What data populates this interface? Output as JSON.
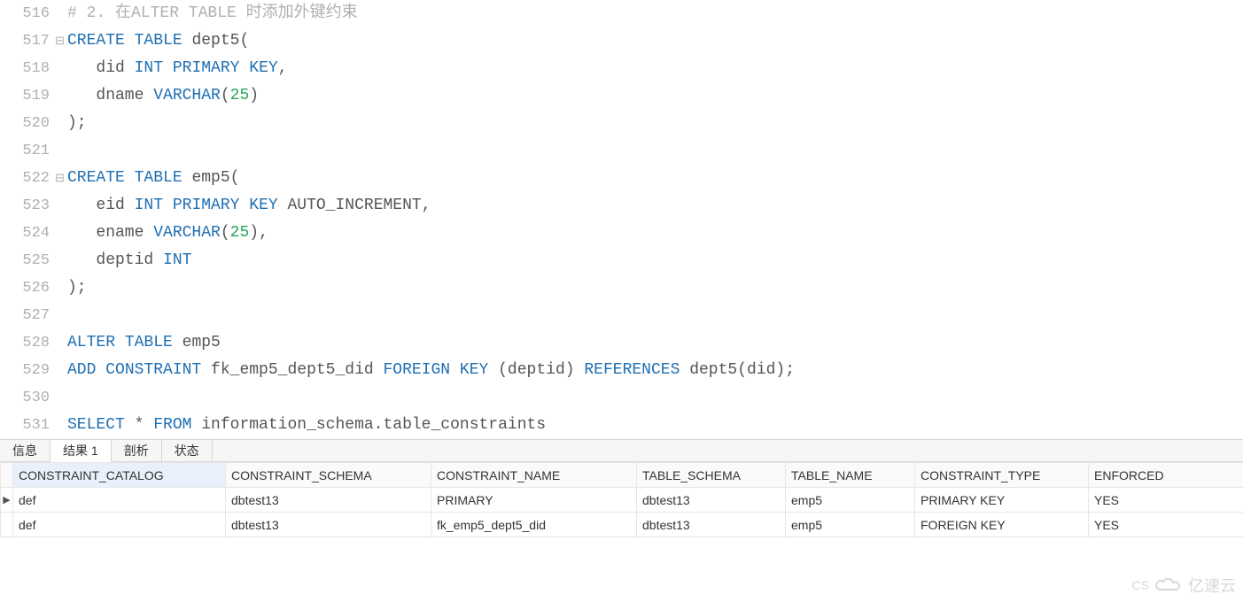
{
  "code": {
    "lines": [
      {
        "num": "516",
        "fold": "",
        "segments": [
          [
            "cm",
            "# 2. 在ALTER TABLE 时添加外键约束"
          ]
        ]
      },
      {
        "num": "517",
        "fold": "⊟",
        "segments": [
          [
            "kw",
            "CREATE"
          ],
          [
            "id",
            " "
          ],
          [
            "kw",
            "TABLE"
          ],
          [
            "id",
            " dept5("
          ]
        ]
      },
      {
        "num": "518",
        "fold": "",
        "segments": [
          [
            "id",
            "   did "
          ],
          [
            "kw",
            "INT"
          ],
          [
            "id",
            " "
          ],
          [
            "kw",
            "PRIMARY"
          ],
          [
            "id",
            " "
          ],
          [
            "kw",
            "KEY"
          ],
          [
            "id",
            ","
          ]
        ]
      },
      {
        "num": "519",
        "fold": "",
        "segments": [
          [
            "id",
            "   dname "
          ],
          [
            "kw",
            "VARCHAR"
          ],
          [
            "id",
            "("
          ],
          [
            "num",
            "25"
          ],
          [
            "id",
            ")"
          ]
        ]
      },
      {
        "num": "520",
        "fold": "└",
        "segments": [
          [
            "id",
            ");"
          ]
        ]
      },
      {
        "num": "521",
        "fold": "",
        "segments": []
      },
      {
        "num": "522",
        "fold": "⊟",
        "segments": [
          [
            "kw",
            "CREATE"
          ],
          [
            "id",
            " "
          ],
          [
            "kw",
            "TABLE"
          ],
          [
            "id",
            " emp5("
          ]
        ]
      },
      {
        "num": "523",
        "fold": "",
        "segments": [
          [
            "id",
            "   eid "
          ],
          [
            "kw",
            "INT"
          ],
          [
            "id",
            " "
          ],
          [
            "kw",
            "PRIMARY"
          ],
          [
            "id",
            " "
          ],
          [
            "kw",
            "KEY"
          ],
          [
            "id",
            " AUTO_INCREMENT,"
          ]
        ]
      },
      {
        "num": "524",
        "fold": "",
        "segments": [
          [
            "id",
            "   ename "
          ],
          [
            "kw",
            "VARCHAR"
          ],
          [
            "id",
            "("
          ],
          [
            "num",
            "25"
          ],
          [
            "id",
            "),"
          ]
        ]
      },
      {
        "num": "525",
        "fold": "",
        "segments": [
          [
            "id",
            "   deptid "
          ],
          [
            "kw",
            "INT"
          ]
        ]
      },
      {
        "num": "526",
        "fold": "└",
        "segments": [
          [
            "id",
            ");"
          ]
        ]
      },
      {
        "num": "527",
        "fold": "",
        "segments": []
      },
      {
        "num": "528",
        "fold": "",
        "segments": [
          [
            "kw",
            "ALTER"
          ],
          [
            "id",
            " "
          ],
          [
            "kw",
            "TABLE"
          ],
          [
            "id",
            " emp5"
          ]
        ]
      },
      {
        "num": "529",
        "fold": "",
        "segments": [
          [
            "kw",
            "ADD"
          ],
          [
            "id",
            " "
          ],
          [
            "kw",
            "CONSTRAINT"
          ],
          [
            "id",
            " fk_emp5_dept5_did "
          ],
          [
            "kw",
            "FOREIGN"
          ],
          [
            "id",
            " "
          ],
          [
            "kw",
            "KEY"
          ],
          [
            "id",
            " (deptid) "
          ],
          [
            "kw",
            "REFERENCES"
          ],
          [
            "id",
            " dept5(did);"
          ]
        ]
      },
      {
        "num": "530",
        "fold": "",
        "segments": []
      },
      {
        "num": "531",
        "fold": "",
        "segments": [
          [
            "kw",
            "SELECT"
          ],
          [
            "id",
            " * "
          ],
          [
            "kw",
            "FROM"
          ],
          [
            "id",
            " information_schema.table_constraints"
          ]
        ]
      }
    ]
  },
  "tabs": {
    "items": [
      "信息",
      "结果 1",
      "剖析",
      "状态"
    ],
    "active_index": 1
  },
  "results": {
    "headers": [
      "CONSTRAINT_CATALOG",
      "CONSTRAINT_SCHEMA",
      "CONSTRAINT_NAME",
      "TABLE_SCHEMA",
      "TABLE_NAME",
      "CONSTRAINT_TYPE",
      "ENFORCED"
    ],
    "rows": [
      [
        "def",
        "dbtest13",
        "PRIMARY",
        "dbtest13",
        "emp5",
        "PRIMARY KEY",
        "YES"
      ],
      [
        "def",
        "dbtest13",
        "fk_emp5_dept5_did",
        "dbtest13",
        "emp5",
        "FOREIGN KEY",
        "YES"
      ]
    ],
    "current_row": 0
  },
  "watermark": {
    "left": "CS",
    "right": "亿速云"
  }
}
